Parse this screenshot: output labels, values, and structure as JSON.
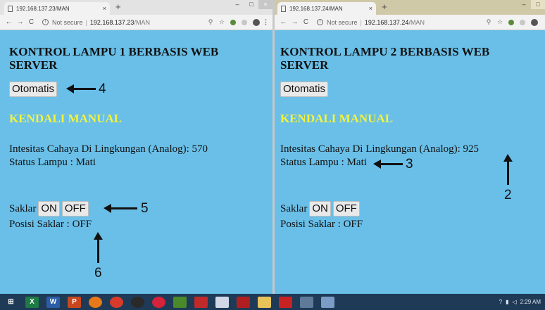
{
  "left_window": {
    "tab_title": "192.168.137.23/MAN",
    "url_host": "192.168.137.23",
    "url_path": "/MAN",
    "security_label": "Not secure",
    "heading": "KONTROL LAMPU 1 BERBASIS WEB SERVER",
    "auto_button": "Otomatis",
    "manual_label": "KENDALI MANUAL",
    "intensity_text": "Intesitas Cahaya Di Lingkungan (Analog): 570",
    "status_text": "Status Lampu : Mati",
    "saklar_label": "Saklar",
    "on_button": "ON",
    "off_button": "OFF",
    "posisi_text": "Posisi Saklar : OFF"
  },
  "right_window": {
    "tab_title": "192.168.137.24/MAN",
    "url_host": "192.168.137.24",
    "url_path": "/MAN",
    "security_label": "Not secure",
    "heading": "KONTROL LAMPU 2 BERBASIS WEB SERVER",
    "auto_button": "Otomatis",
    "manual_label": "KENDALI MANUAL",
    "intensity_text": "Intesitas Cahaya Di Lingkungan (Analog): 925",
    "status_text": "Status Lampu : Mati",
    "saklar_label": "Saklar",
    "on_button": "ON",
    "off_button": "OFF",
    "posisi_text": "Posisi Saklar : OFF"
  },
  "browser": {
    "new_tab": "+",
    "close_tab": "×",
    "back": "←",
    "forward": "→",
    "reload": "C",
    "minimize": "–",
    "maximize": "□",
    "close_window": "×",
    "search_glyph": "⚲",
    "star_glyph": "☆",
    "menu_glyph": "⋮"
  },
  "annotations": {
    "n2": "2",
    "n3": "3",
    "n4": "4",
    "n5": "5",
    "n6": "6"
  },
  "taskbar": {
    "clock_time": "2:29 AM",
    "icons": [
      "windows-logo-icon",
      "excel-icon",
      "word-icon",
      "powerpoint-icon",
      "firefox-icon",
      "chrome-icon",
      "media-icon",
      "app-icon",
      "plant-icon",
      "red-app-icon",
      "file-icon",
      "acrobat-icon",
      "folder-icon",
      "acrobat-reader-icon",
      "tool-icon",
      "paint-icon"
    ]
  },
  "colors": {
    "page_background": "#69bfe8",
    "manual_label": "#f3f33d",
    "taskbar": "#1f3a57"
  }
}
